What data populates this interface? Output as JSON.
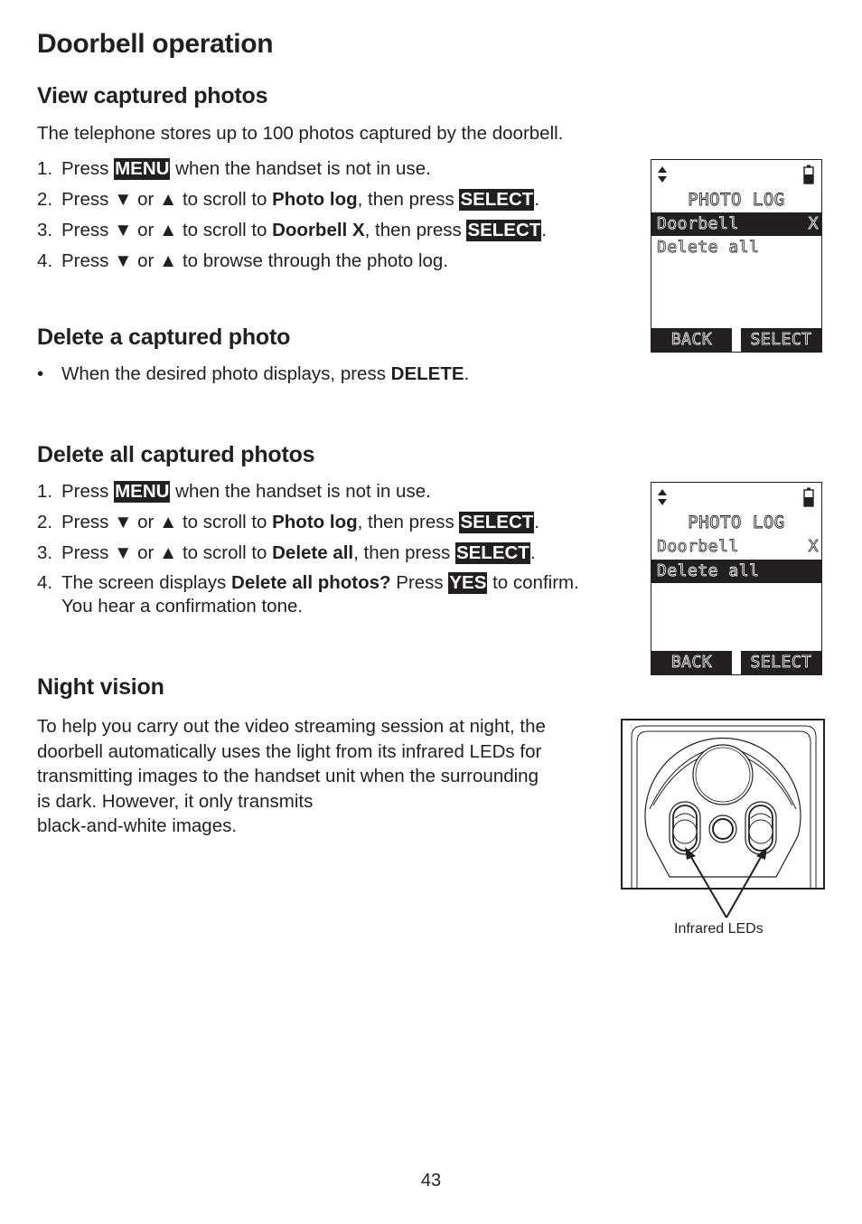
{
  "page": {
    "title": "Doorbell operation",
    "page_number": "43"
  },
  "view": {
    "heading": "View captured photos",
    "intro": "The telephone stores up to 100 photos captured by the doorbell.",
    "steps": [
      {
        "num": "1.",
        "a": "Press ",
        "key": "MENU",
        "b": " when the handset is not in use."
      },
      {
        "num": "2.",
        "a": "Press ▼ or ▲ to scroll to ",
        "bold": "Photo log",
        "c": ", then press ",
        "key": "SELECT",
        "d": "."
      },
      {
        "num": "3.",
        "a": "Press ▼ or ▲ to scroll to ",
        "bold": "Doorbell X",
        "c": ", then press ",
        "key": "SELECT",
        "d": "."
      },
      {
        "num": "4.",
        "a": "Press ▼ or ▲ to browse through the photo log."
      }
    ]
  },
  "delete_one": {
    "heading": "Delete a captured photo",
    "bullet": "•",
    "text": "When the desired photo displays, press ",
    "bold": "DELETE",
    "end": "."
  },
  "delete_all": {
    "heading": "Delete all captured photos",
    "steps": [
      {
        "num": "1.",
        "a": "Press ",
        "key": "MENU",
        "b": " when the handset is not in use."
      },
      {
        "num": "2.",
        "a": "Press ▼ or ▲ to scroll to ",
        "bold": "Photo log",
        "c": ", then press ",
        "key": "SELECT",
        "d": "."
      },
      {
        "num": "3.",
        "a": "Press ▼ or ▲ to scroll to ",
        "bold": "Delete all",
        "c": ", then press ",
        "key": "SELECT",
        "d": "."
      },
      {
        "num": "4.",
        "a": "The screen displays ",
        "bold": "Delete all photos?",
        "c": " Press ",
        "key": "YES",
        "d": " to confirm.",
        "line2": "You hear a confirmation tone."
      }
    ]
  },
  "screen1": {
    "title": "PHOTO LOG",
    "items": [
      {
        "label": "Doorbell",
        "suffix": "X",
        "selected": true
      },
      {
        "label": "Delete all",
        "suffix": "",
        "selected": false
      }
    ],
    "soft_left": "BACK",
    "soft_right": "SELECT"
  },
  "screen2": {
    "title": "PHOTO LOG",
    "items": [
      {
        "label": "Doorbell",
        "suffix": "X",
        "selected": false
      },
      {
        "label": "Delete all",
        "suffix": "",
        "selected": true
      }
    ],
    "soft_left": "BACK",
    "soft_right": "SELECT"
  },
  "night": {
    "heading": "Night vision",
    "lines": [
      "To help you carry out the video streaming session at night, the",
      "doorbell automatically uses the light from its infrared LEDs for",
      "transmitting images to the handset unit when the surrounding",
      "is dark. However, it only transmits",
      "black-and-white images."
    ],
    "figure_caption": "Infrared LEDs"
  }
}
